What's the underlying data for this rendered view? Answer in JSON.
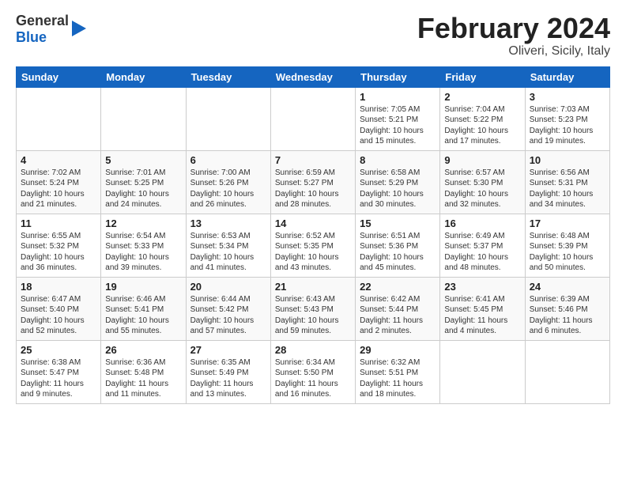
{
  "header": {
    "logo": {
      "line1": "General",
      "line2": "Blue"
    },
    "title": "February 2024",
    "location": "Oliveri, Sicily, Italy"
  },
  "calendar": {
    "days_of_week": [
      "Sunday",
      "Monday",
      "Tuesday",
      "Wednesday",
      "Thursday",
      "Friday",
      "Saturday"
    ],
    "weeks": [
      [
        {
          "day": "",
          "content": ""
        },
        {
          "day": "",
          "content": ""
        },
        {
          "day": "",
          "content": ""
        },
        {
          "day": "",
          "content": ""
        },
        {
          "day": "1",
          "content": "Sunrise: 7:05 AM\nSunset: 5:21 PM\nDaylight: 10 hours\nand 15 minutes."
        },
        {
          "day": "2",
          "content": "Sunrise: 7:04 AM\nSunset: 5:22 PM\nDaylight: 10 hours\nand 17 minutes."
        },
        {
          "day": "3",
          "content": "Sunrise: 7:03 AM\nSunset: 5:23 PM\nDaylight: 10 hours\nand 19 minutes."
        }
      ],
      [
        {
          "day": "4",
          "content": "Sunrise: 7:02 AM\nSunset: 5:24 PM\nDaylight: 10 hours\nand 21 minutes."
        },
        {
          "day": "5",
          "content": "Sunrise: 7:01 AM\nSunset: 5:25 PM\nDaylight: 10 hours\nand 24 minutes."
        },
        {
          "day": "6",
          "content": "Sunrise: 7:00 AM\nSunset: 5:26 PM\nDaylight: 10 hours\nand 26 minutes."
        },
        {
          "day": "7",
          "content": "Sunrise: 6:59 AM\nSunset: 5:27 PM\nDaylight: 10 hours\nand 28 minutes."
        },
        {
          "day": "8",
          "content": "Sunrise: 6:58 AM\nSunset: 5:29 PM\nDaylight: 10 hours\nand 30 minutes."
        },
        {
          "day": "9",
          "content": "Sunrise: 6:57 AM\nSunset: 5:30 PM\nDaylight: 10 hours\nand 32 minutes."
        },
        {
          "day": "10",
          "content": "Sunrise: 6:56 AM\nSunset: 5:31 PM\nDaylight: 10 hours\nand 34 minutes."
        }
      ],
      [
        {
          "day": "11",
          "content": "Sunrise: 6:55 AM\nSunset: 5:32 PM\nDaylight: 10 hours\nand 36 minutes."
        },
        {
          "day": "12",
          "content": "Sunrise: 6:54 AM\nSunset: 5:33 PM\nDaylight: 10 hours\nand 39 minutes."
        },
        {
          "day": "13",
          "content": "Sunrise: 6:53 AM\nSunset: 5:34 PM\nDaylight: 10 hours\nand 41 minutes."
        },
        {
          "day": "14",
          "content": "Sunrise: 6:52 AM\nSunset: 5:35 PM\nDaylight: 10 hours\nand 43 minutes."
        },
        {
          "day": "15",
          "content": "Sunrise: 6:51 AM\nSunset: 5:36 PM\nDaylight: 10 hours\nand 45 minutes."
        },
        {
          "day": "16",
          "content": "Sunrise: 6:49 AM\nSunset: 5:37 PM\nDaylight: 10 hours\nand 48 minutes."
        },
        {
          "day": "17",
          "content": "Sunrise: 6:48 AM\nSunset: 5:39 PM\nDaylight: 10 hours\nand 50 minutes."
        }
      ],
      [
        {
          "day": "18",
          "content": "Sunrise: 6:47 AM\nSunset: 5:40 PM\nDaylight: 10 hours\nand 52 minutes."
        },
        {
          "day": "19",
          "content": "Sunrise: 6:46 AM\nSunset: 5:41 PM\nDaylight: 10 hours\nand 55 minutes."
        },
        {
          "day": "20",
          "content": "Sunrise: 6:44 AM\nSunset: 5:42 PM\nDaylight: 10 hours\nand 57 minutes."
        },
        {
          "day": "21",
          "content": "Sunrise: 6:43 AM\nSunset: 5:43 PM\nDaylight: 10 hours\nand 59 minutes."
        },
        {
          "day": "22",
          "content": "Sunrise: 6:42 AM\nSunset: 5:44 PM\nDaylight: 11 hours\nand 2 minutes."
        },
        {
          "day": "23",
          "content": "Sunrise: 6:41 AM\nSunset: 5:45 PM\nDaylight: 11 hours\nand 4 minutes."
        },
        {
          "day": "24",
          "content": "Sunrise: 6:39 AM\nSunset: 5:46 PM\nDaylight: 11 hours\nand 6 minutes."
        }
      ],
      [
        {
          "day": "25",
          "content": "Sunrise: 6:38 AM\nSunset: 5:47 PM\nDaylight: 11 hours\nand 9 minutes."
        },
        {
          "day": "26",
          "content": "Sunrise: 6:36 AM\nSunset: 5:48 PM\nDaylight: 11 hours\nand 11 minutes."
        },
        {
          "day": "27",
          "content": "Sunrise: 6:35 AM\nSunset: 5:49 PM\nDaylight: 11 hours\nand 13 minutes."
        },
        {
          "day": "28",
          "content": "Sunrise: 6:34 AM\nSunset: 5:50 PM\nDaylight: 11 hours\nand 16 minutes."
        },
        {
          "day": "29",
          "content": "Sunrise: 6:32 AM\nSunset: 5:51 PM\nDaylight: 11 hours\nand 18 minutes."
        },
        {
          "day": "",
          "content": ""
        },
        {
          "day": "",
          "content": ""
        }
      ]
    ]
  }
}
